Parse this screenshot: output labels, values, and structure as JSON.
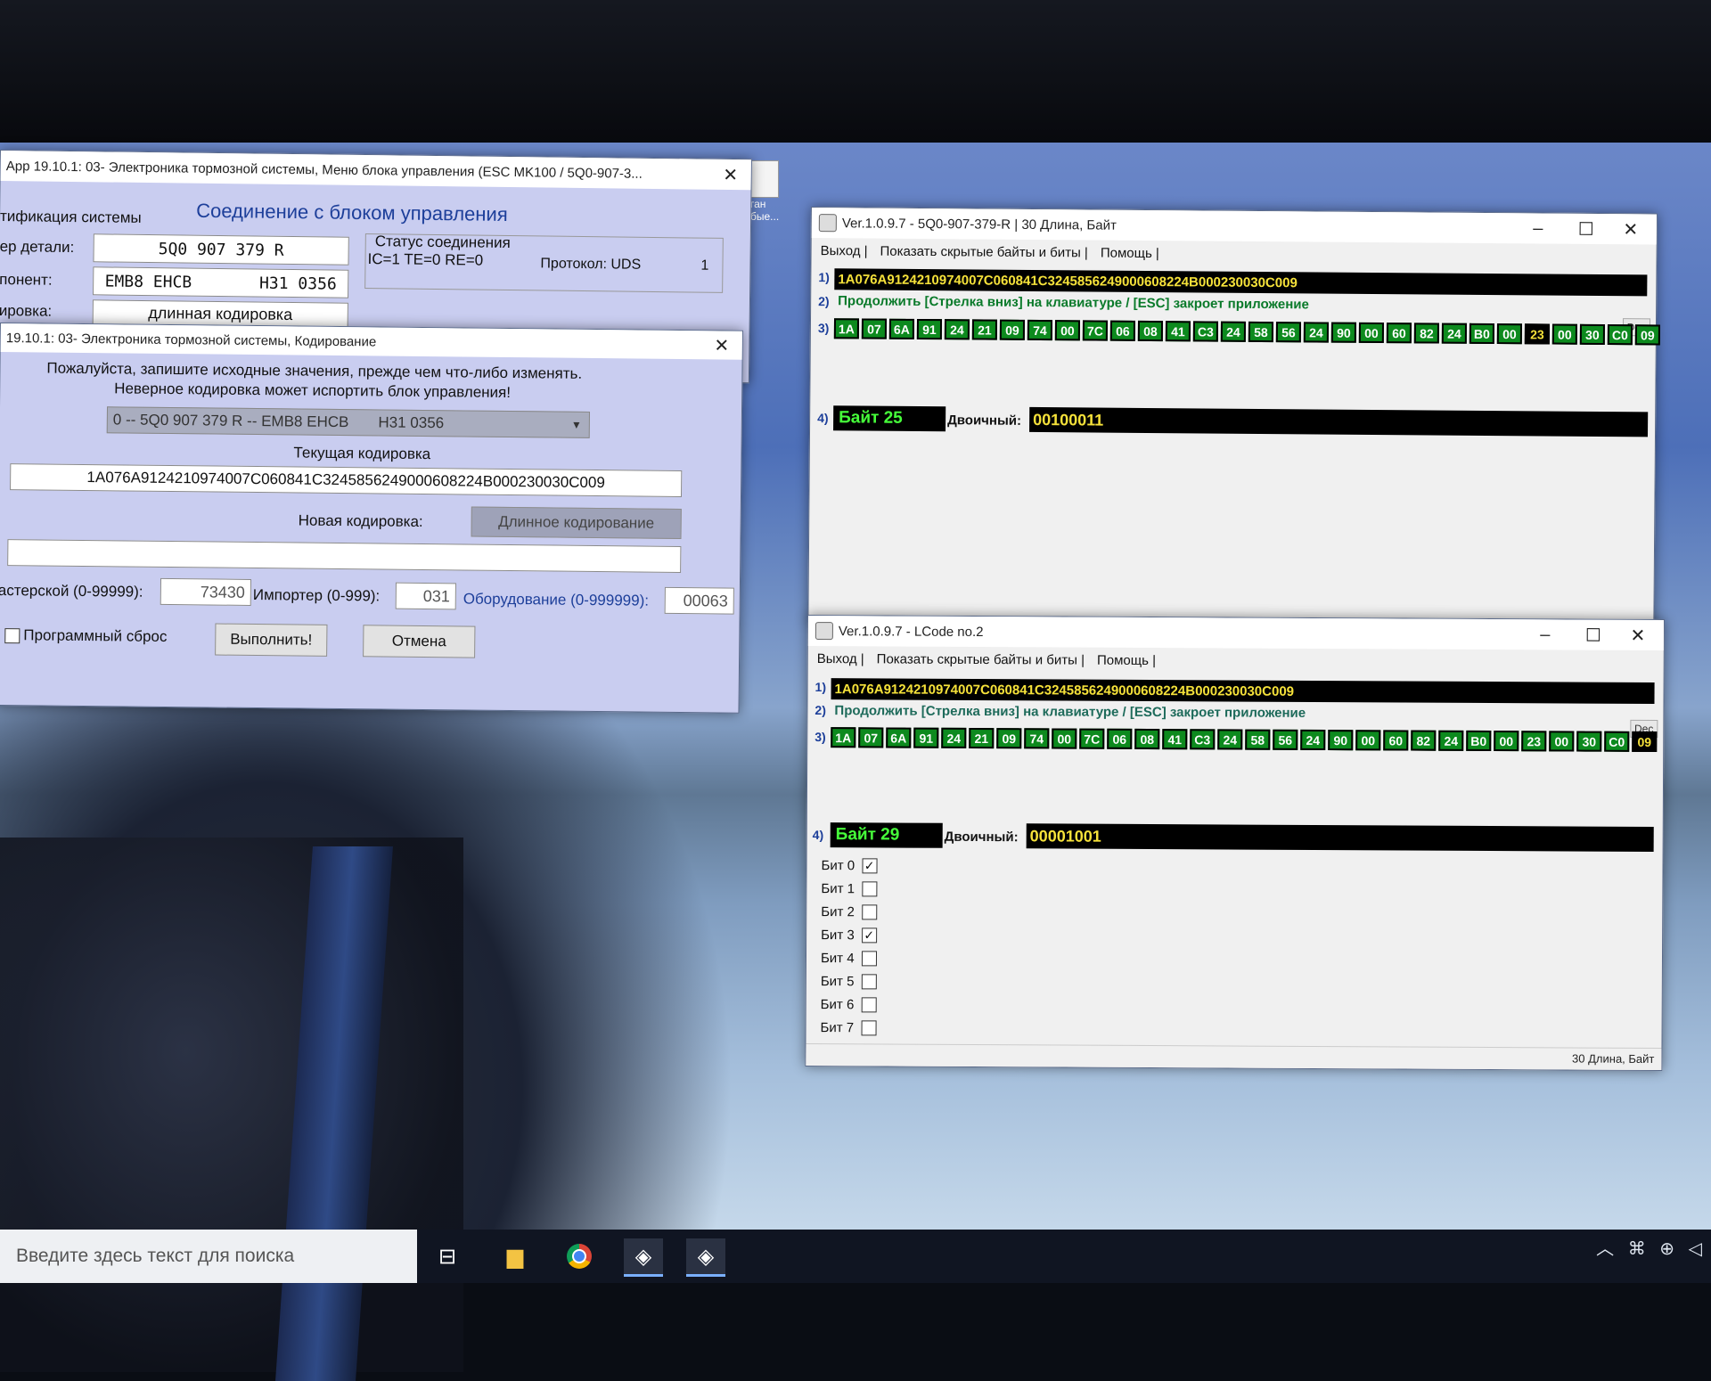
{
  "vcds_main": {
    "title": "App 19.10.1: 03- Электроника тормозной системы,  Меню блока управления (ESC MK100 / 5Q0-907-3...",
    "ident_label": "тификация системы",
    "heading": "Соединение с блоком управления",
    "part_label": "ер детали:",
    "part_value": "5Q0 907 379 R",
    "component_label": "понент:",
    "component_value": "EMB8 EHCB       H31 0356",
    "coding_label": "ировка:",
    "coding_value": "длинная кодировка",
    "status_title": "Статус соединения",
    "status_values": "IC=1  TE=0   RE=0",
    "protocol": "Протокол: UDS",
    "protocol_num": "1"
  },
  "vcds_coding": {
    "title": "19.10.1: 03- Электроника тормозной системы,  Кодирование",
    "warning_1": "Пожалуйста, запишите исходные значения, прежде чем что-либо изменять.",
    "warning_2": "Неверное кодировка может испортить блок управления!",
    "dropdown": "0 -- 5Q0 907 379 R -- EMB8 EHCB       H31 0356",
    "current_label": "Текущая кодировка",
    "current_value": "1A076A9124210974007C060841C3245856249000608224B000230030C009",
    "new_label": "Новая кодировка:",
    "long_coding_button": "Длинное кодирование",
    "new_value": "",
    "workshop_label": "астерской (0-99999):",
    "workshop_value": "73430",
    "importer_label": "Импортер (0-999):",
    "importer_value": "031",
    "equipment_label": "Оборудование (0-999999):",
    "equipment_value": "00063",
    "reset_label": "Программный сброс",
    "execute_button": "Выполнить!",
    "cancel_button": "Отмена"
  },
  "lcode_1": {
    "title": "Ver.1.0.9.7 -    5Q0-907-379-R | 30 Длина, Байт",
    "menu": [
      "Выход |",
      "Показать скрытые байты и биты |",
      "Помощь |"
    ],
    "row1_num": "1)",
    "coding": "1A076A9124210974007C060841C3245856249000608224B000230030C009",
    "row2_num": "2)",
    "prompt": "Продолжить [Стрелка вниз] на клавиатуре / [ESC] закроет приложение",
    "dec": "Dec",
    "row3_num": "3)",
    "bytes": [
      "1A",
      "07",
      "6A",
      "91",
      "24",
      "21",
      "09",
      "74",
      "00",
      "7C",
      "06",
      "08",
      "41",
      "C3",
      "24",
      "58",
      "56",
      "24",
      "90",
      "00",
      "60",
      "82",
      "24",
      "B0",
      "00",
      "23",
      "00",
      "30",
      "C0",
      "09"
    ],
    "selected_index": 25,
    "row4_num": "4)",
    "byte_label": "Байт 25",
    "binary_label": "Двоичный:",
    "binary_value": "00100011"
  },
  "lcode_2": {
    "title": "Ver.1.0.9.7 - LCode no.2",
    "menu": [
      "Выход |",
      "Показать скрытые байты и биты |",
      "Помощь |"
    ],
    "row1_num": "1)",
    "coding": "1A076A9124210974007C060841C3245856249000608224B000230030C009",
    "row2_num": "2)",
    "prompt": "Продолжить [Стрелка вниз] на клавиатуре / [ESC] закроет приложение",
    "dec": "Dec",
    "row3_num": "3)",
    "bytes": [
      "1A",
      "07",
      "6A",
      "91",
      "24",
      "21",
      "09",
      "74",
      "00",
      "7C",
      "06",
      "08",
      "41",
      "C3",
      "24",
      "58",
      "56",
      "24",
      "90",
      "00",
      "60",
      "82",
      "24",
      "B0",
      "00",
      "23",
      "00",
      "30",
      "C0",
      "09"
    ],
    "selected_index": 29,
    "row4_num": "4)",
    "byte_label": "Байт 29",
    "binary_label": "Двоичный:",
    "binary_value": "00001001",
    "bits": [
      {
        "label": "Бит 0",
        "checked": true
      },
      {
        "label": "Бит 1",
        "checked": false
      },
      {
        "label": "Бит 2",
        "checked": false
      },
      {
        "label": "Бит 3",
        "checked": true
      },
      {
        "label": "Бит 4",
        "checked": false
      },
      {
        "label": "Бит 5",
        "checked": false
      },
      {
        "label": "Бит 6",
        "checked": false
      },
      {
        "label": "Бит 7",
        "checked": false
      }
    ],
    "status": "30 Длина, Байт"
  },
  "desktop_icon_label": "ган\nбые...",
  "taskbar": {
    "search_placeholder": "Введите здесь текст для поиска",
    "icons": [
      "task-view-icon",
      "file-explorer-icon",
      "chrome-icon",
      "lcode-app-icon",
      "lcode-app-icon-2"
    ]
  }
}
